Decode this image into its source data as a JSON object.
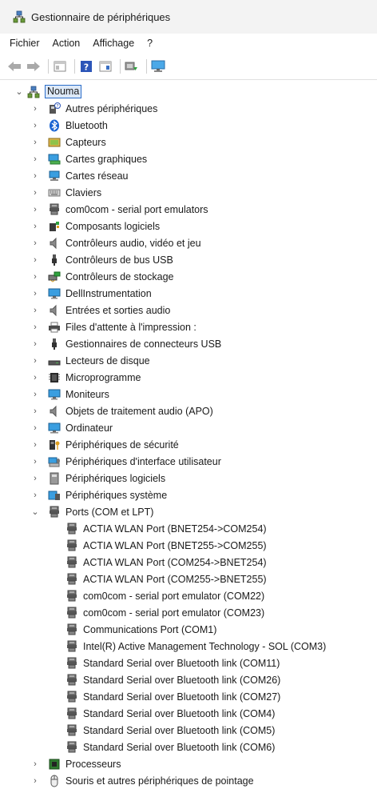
{
  "window": {
    "title": "Gestionnaire de périphériques"
  },
  "menu": [
    "Fichier",
    "Action",
    "Affichage",
    "?"
  ],
  "toolbar": {
    "buttons": [
      "back-icon",
      "forward-icon",
      "properties-icon",
      "help-icon",
      "view-icon",
      "update-driver-icon",
      "monitor-icon"
    ]
  },
  "tree": {
    "root": "Nouma",
    "categories": [
      {
        "label": "Autres périphériques",
        "icon": "unknown-device-icon",
        "expanded": false
      },
      {
        "label": "Bluetooth",
        "icon": "bluetooth-icon",
        "expanded": false
      },
      {
        "label": "Capteurs",
        "icon": "sensor-icon",
        "expanded": false
      },
      {
        "label": "Cartes graphiques",
        "icon": "display-adapter-icon",
        "expanded": false
      },
      {
        "label": "Cartes réseau",
        "icon": "network-adapter-icon",
        "expanded": false
      },
      {
        "label": "Claviers",
        "icon": "keyboard-icon",
        "expanded": false
      },
      {
        "label": "com0com - serial port emulators",
        "icon": "port-icon",
        "expanded": false
      },
      {
        "label": "Composants logiciels",
        "icon": "software-component-icon",
        "expanded": false
      },
      {
        "label": "Contrôleurs audio, vidéo et jeu",
        "icon": "speaker-icon",
        "expanded": false
      },
      {
        "label": "Contrôleurs de bus USB",
        "icon": "usb-icon",
        "expanded": false
      },
      {
        "label": "Contrôleurs de stockage",
        "icon": "storage-controller-icon",
        "expanded": false
      },
      {
        "label": "DellInstrumentation",
        "icon": "monitor-icon",
        "expanded": false
      },
      {
        "label": "Entrées et sorties audio",
        "icon": "speaker-icon",
        "expanded": false
      },
      {
        "label": "Files d'attente à l'impression :",
        "icon": "printer-icon",
        "expanded": false
      },
      {
        "label": "Gestionnaires de connecteurs USB",
        "icon": "usb-icon",
        "expanded": false
      },
      {
        "label": "Lecteurs de disque",
        "icon": "disk-icon",
        "expanded": false
      },
      {
        "label": "Microprogramme",
        "icon": "firmware-icon",
        "expanded": false
      },
      {
        "label": "Moniteurs",
        "icon": "monitor-icon",
        "expanded": false
      },
      {
        "label": "Objets de traitement audio (APO)",
        "icon": "speaker-icon",
        "expanded": false
      },
      {
        "label": "Ordinateur",
        "icon": "computer-icon",
        "expanded": false
      },
      {
        "label": "Périphériques de sécurité",
        "icon": "security-device-icon",
        "expanded": false
      },
      {
        "label": "Périphériques d'interface utilisateur",
        "icon": "hid-icon",
        "expanded": false
      },
      {
        "label": "Périphériques logiciels",
        "icon": "software-device-icon",
        "expanded": false
      },
      {
        "label": "Périphériques système",
        "icon": "system-device-icon",
        "expanded": false
      },
      {
        "label": "Ports (COM et LPT)",
        "icon": "port-icon",
        "expanded": true,
        "children": [
          "ACTIA WLAN Port (BNET254->COM254)",
          "ACTIA WLAN Port (BNET255->COM255)",
          "ACTIA WLAN Port (COM254->BNET254)",
          "ACTIA WLAN Port (COM255->BNET255)",
          "com0com - serial port emulator (COM22)",
          "com0com - serial port emulator (COM23)",
          "Communications Port (COM1)",
          "Intel(R) Active Management Technology - SOL (COM3)",
          "Standard Serial over Bluetooth link (COM11)",
          "Standard Serial over Bluetooth link (COM26)",
          "Standard Serial over Bluetooth link (COM27)",
          "Standard Serial over Bluetooth link (COM4)",
          "Standard Serial over Bluetooth link (COM5)",
          "Standard Serial over Bluetooth link (COM6)"
        ]
      },
      {
        "label": "Processeurs",
        "icon": "processor-icon",
        "expanded": false
      },
      {
        "label": "Souris et autres périphériques de pointage",
        "icon": "mouse-icon",
        "expanded": false
      }
    ]
  }
}
